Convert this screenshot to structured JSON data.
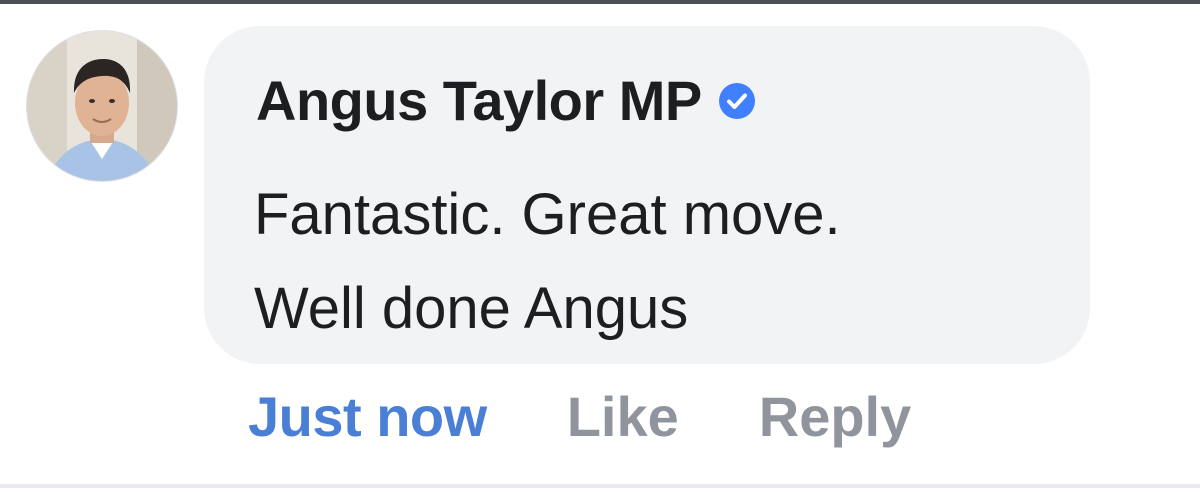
{
  "comment": {
    "author": "Angus Taylor MP",
    "verified_icon": "verified-badge-icon",
    "text_lines": [
      "Fantastic. Great move.",
      "Well done Angus"
    ],
    "timestamp": "Just now",
    "like_label": "Like",
    "reply_label": "Reply"
  },
  "colors": {
    "bubble": "#f2f3f5",
    "text": "#1c1e21",
    "timestamp": "#4a7fd6",
    "action": "#90949c",
    "verified": "#4080ff"
  }
}
